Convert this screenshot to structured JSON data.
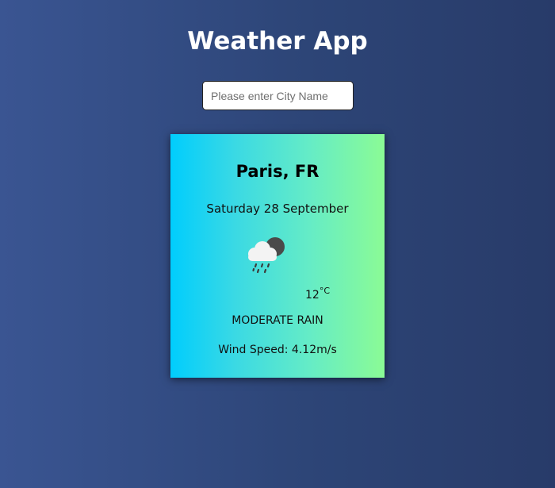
{
  "app": {
    "title": "Weather App"
  },
  "search": {
    "placeholder": "Please enter City Name",
    "value": ""
  },
  "weather": {
    "city": "Paris, FR",
    "date": "Saturday 28 September",
    "icon": "cloud-rain-night-icon",
    "temperature": "12",
    "unit": "°C",
    "description": "MODERATE RAIN",
    "wind": "Wind Speed: 4.12m/s"
  },
  "colors": {
    "background_left": "#3a5592",
    "background_right": "#283b69",
    "card_gradient_start": "#00cdfd",
    "card_gradient_end": "#8bfb95"
  }
}
